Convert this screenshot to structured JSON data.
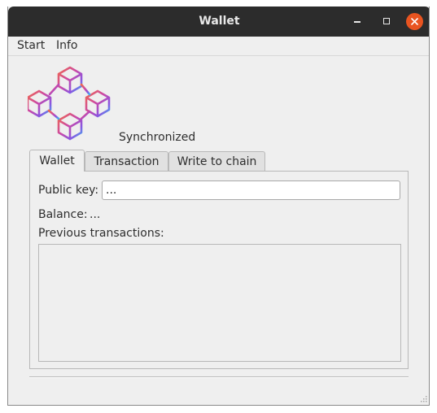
{
  "window": {
    "title": "Wallet",
    "controls": [
      "minimize-icon",
      "maximize-icon",
      "close-icon"
    ],
    "close_color": "#e95420"
  },
  "menu": {
    "items": [
      "Start",
      "Info"
    ]
  },
  "header": {
    "logo_icon": "blockchain-cubes-icon",
    "status": "Synchronized"
  },
  "tabs": {
    "items": [
      "Wallet",
      "Transaction",
      "Write to chain"
    ],
    "active": "Wallet"
  },
  "wallet": {
    "public_key_label": "Public key:",
    "public_key_value": "...",
    "balance_label": "Balance:",
    "balance_value": "...",
    "previous_transactions_label": "Previous transactions:",
    "previous_transactions": []
  }
}
